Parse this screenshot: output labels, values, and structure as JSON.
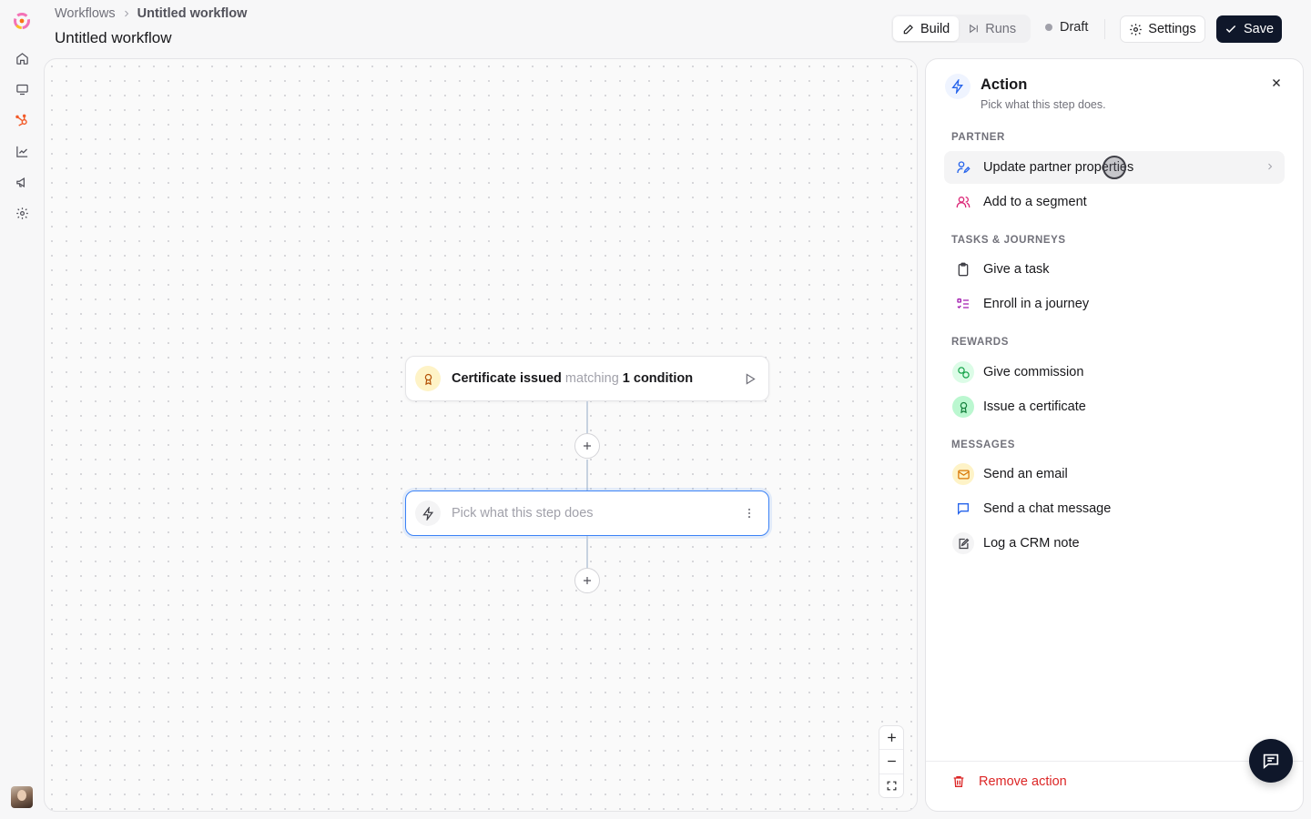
{
  "breadcrumb": {
    "root": "Workflows",
    "current": "Untitled workflow"
  },
  "page_title": "Untitled workflow",
  "mode_tabs": [
    {
      "label": "Build",
      "icon": "pencil-icon",
      "active": true
    },
    {
      "label": "Runs",
      "icon": "skip-forward-icon",
      "active": false
    }
  ],
  "status": {
    "label": "Draft",
    "color": "#a1a1aa"
  },
  "toolbar": {
    "settings_label": "Settings",
    "save_label": "Save"
  },
  "sidebar_nav": [
    "home-icon",
    "monitor-icon",
    "hubspot-icon",
    "chart-icon",
    "megaphone-icon",
    "gear-icon"
  ],
  "canvas": {
    "trigger": {
      "strong": "Certificate issued",
      "muted": "matching",
      "condition": "1 condition"
    },
    "action_placeholder": "Pick what this step does"
  },
  "panel": {
    "title": "Action",
    "subtitle": "Pick what this step does.",
    "sections": [
      {
        "heading": "PARTNER",
        "items": [
          {
            "label": "Update partner properties",
            "icon": "user-edit-icon",
            "color": "#2563eb"
          },
          {
            "label": "Add to a segment",
            "icon": "users-icon",
            "color": "#db2777"
          }
        ]
      },
      {
        "heading": "TASKS & JOURNEYS",
        "items": [
          {
            "label": "Give a task",
            "icon": "clipboard-icon",
            "color": "#3f3f46"
          },
          {
            "label": "Enroll in a journey",
            "icon": "list-checks-icon",
            "color": "#a21caf"
          }
        ]
      },
      {
        "heading": "REWARDS",
        "items": [
          {
            "label": "Give commission",
            "icon": "coins-icon",
            "color": "#16a34a"
          },
          {
            "label": "Issue a certificate",
            "icon": "award-icon",
            "color": "#15803d"
          }
        ]
      },
      {
        "heading": "MESSAGES",
        "items": [
          {
            "label": "Send an email",
            "icon": "mail-icon",
            "color": "#d97706"
          },
          {
            "label": "Send a chat message",
            "icon": "message-square-icon",
            "color": "#2563eb"
          },
          {
            "label": "Log a CRM note",
            "icon": "note-edit-icon",
            "color": "#3f3f46"
          }
        ]
      }
    ],
    "remove_label": "Remove action"
  }
}
